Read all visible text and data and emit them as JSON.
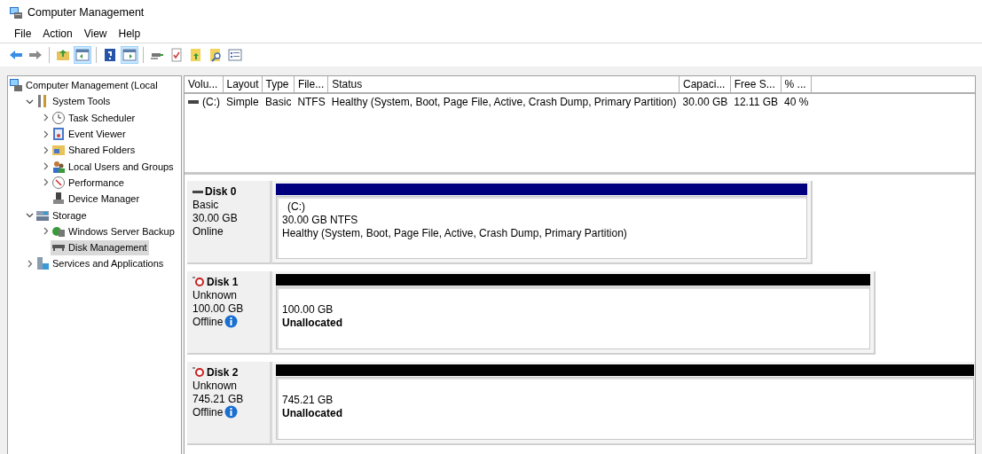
{
  "window": {
    "title": "Computer Management"
  },
  "menu": [
    "File",
    "Action",
    "View",
    "Help"
  ],
  "toolbar": [
    [
      {
        "kind": "back",
        "pressed": false
      },
      {
        "kind": "forward",
        "pressed": false
      }
    ],
    [
      {
        "kind": "up",
        "pressed": false
      },
      {
        "kind": "tree-pane",
        "pressed": true
      }
    ],
    [
      {
        "kind": "help",
        "pressed": false
      },
      {
        "kind": "action-pane",
        "pressed": true
      }
    ],
    [
      {
        "kind": "connect",
        "pressed": false
      },
      {
        "kind": "checklist",
        "pressed": false
      },
      {
        "kind": "folder-up",
        "pressed": false
      },
      {
        "kind": "folder-search",
        "pressed": false
      },
      {
        "kind": "list",
        "pressed": false
      }
    ]
  ],
  "tree": [
    {
      "label": "Computer Management (Local",
      "selected": false,
      "children": [
        {
          "label": "System Tools",
          "expanded": true,
          "selected": false,
          "children": [
            {
              "label": "Task Scheduler",
              "expanded": false,
              "selected": false
            },
            {
              "label": "Event Viewer",
              "expanded": false,
              "selected": false
            },
            {
              "label": "Shared Folders",
              "expanded": false,
              "selected": false
            },
            {
              "label": "Local Users and Groups",
              "expanded": false,
              "selected": false
            },
            {
              "label": "Performance",
              "expanded": false,
              "selected": false
            },
            {
              "label": "Device Manager",
              "selected": false
            }
          ]
        },
        {
          "label": "Storage",
          "expanded": true,
          "selected": false,
          "children": [
            {
              "label": "Windows Server Backup",
              "expanded": false,
              "selected": false
            },
            {
              "label": "Disk Management",
              "selected": true
            }
          ]
        },
        {
          "label": "Services and Applications",
          "expanded": false,
          "selected": false
        }
      ]
    }
  ],
  "volume_table": {
    "columns": [
      "Volu...",
      "Layout",
      "Type",
      "File...",
      "Status",
      "Capaci...",
      "Free S...",
      "% ..."
    ],
    "rows": [
      {
        "cells": [
          "(C:)",
          "Simple",
          "Basic",
          "NTFS",
          "Healthy (System, Boot, Page File, Active, Crash Dump, Primary Partition)",
          "30.00 GB",
          "12.11 GB",
          "40 %"
        ]
      }
    ]
  },
  "disks": [
    {
      "name": "Disk 0",
      "offline": false,
      "info": false,
      "details": [
        "Basic",
        "30.00 GB",
        "Online"
      ],
      "partition": {
        "kind": "primary",
        "lines": [
          "(C:)",
          "30.00 GB NTFS",
          "Healthy (System, Boot, Page File, Active, Crash Dump, Primary Partition)"
        ]
      }
    },
    {
      "name": "Disk 1",
      "offline": true,
      "info": true,
      "details": [
        "Unknown",
        "100.00 GB",
        "Offline"
      ],
      "partition": {
        "kind": "unallocated",
        "lines": [
          "100.00 GB",
          "Unallocated"
        ]
      }
    },
    {
      "name": "Disk 2",
      "offline": true,
      "info": true,
      "details": [
        "Unknown",
        "745.21 GB",
        "Offline"
      ],
      "partition": {
        "kind": "unallocated",
        "lines": [
          "745.21 GB",
          "Unallocated"
        ]
      }
    }
  ]
}
